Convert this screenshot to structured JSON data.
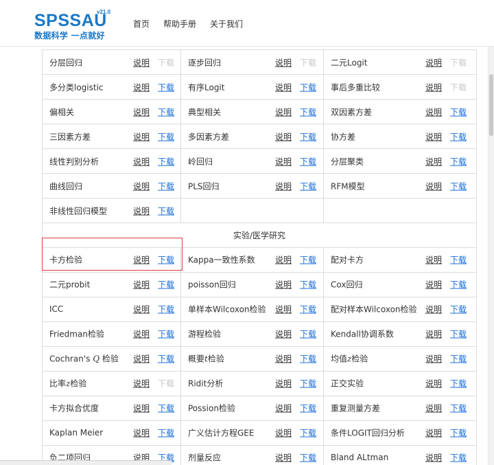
{
  "header": {
    "logo_text": "SPSSAU",
    "logo_version": "v21.0",
    "logo_slogan": "数据科学  一点就好",
    "nav": [
      "首页",
      "帮助手册",
      "关于我们"
    ]
  },
  "labels": {
    "explain": "说明",
    "download": "下载"
  },
  "colors": {
    "brand": "#1a78c9",
    "link": "#1a6ed8",
    "disabled": "#c8c8c8",
    "highlight": "#e03a3a"
  },
  "rows": [
    [
      {
        "name": "分层回归",
        "download": false
      },
      {
        "name": "逐步回归",
        "download": false
      },
      {
        "name": "二元Logit",
        "download": false
      }
    ],
    [
      {
        "name": "多分类logistic",
        "download": true
      },
      {
        "name": "有序Logit",
        "download": true
      },
      {
        "name": "事后多重比较",
        "download": false
      }
    ],
    [
      {
        "name": "偏相关",
        "download": true
      },
      {
        "name": "典型相关",
        "download": true
      },
      {
        "name": "双因素方差",
        "download": true
      }
    ],
    [
      {
        "name": "三因素方差",
        "download": true
      },
      {
        "name": "多因素方差",
        "download": true
      },
      {
        "name": "协方差",
        "download": true
      }
    ],
    [
      {
        "name": "线性判别分析",
        "download": true
      },
      {
        "name": "岭回归",
        "download": true
      },
      {
        "name": "分层聚类",
        "download": true
      }
    ],
    [
      {
        "name": "曲线回归",
        "download": true
      },
      {
        "name": "PLS回归",
        "download": true
      },
      {
        "name": "RFM模型",
        "download": true
      }
    ],
    [
      {
        "name": "非线性回归模型",
        "download": true
      },
      null,
      null
    ]
  ],
  "section": {
    "title": "实验/医学研究",
    "rows": [
      [
        {
          "name": "卡方检验",
          "download": true
        },
        {
          "name": "Kappa一致性系数",
          "download": true
        },
        {
          "name": "配对卡方",
          "download": true
        }
      ],
      [
        {
          "name": "二元probit",
          "download": true
        },
        {
          "name": "poisson回归",
          "download": true
        },
        {
          "name": "Cox回归",
          "download": true
        }
      ],
      [
        {
          "name": "ICC",
          "download": true
        },
        {
          "name": "单样本Wilcoxon检验",
          "download": true
        },
        {
          "name": "配对样本Wilcoxon检验",
          "download": true
        }
      ],
      [
        {
          "name": "Friedman检验",
          "download": true
        },
        {
          "name": "游程检验",
          "download": true
        },
        {
          "name": "Kendall协调系数",
          "download": true
        }
      ],
      [
        {
          "name": "Cochran's Q 检验",
          "download": true
        },
        {
          "name": "概要t检验",
          "download": true
        },
        {
          "name": "均值z检验",
          "download": true
        }
      ],
      [
        {
          "name": "比率z检验",
          "download": false
        },
        {
          "name": "Ridit分析",
          "download": true
        },
        {
          "name": "正交实验",
          "download": true
        }
      ],
      [
        {
          "name": "卡方拟合优度",
          "download": true
        },
        {
          "name": "Possion检验",
          "download": true
        },
        {
          "name": "重复测量方差",
          "download": true
        }
      ],
      [
        {
          "name": "Kaplan Meier",
          "download": true
        },
        {
          "name": "广义估计方程GEE",
          "download": true
        },
        {
          "name": "条件LOGIT回归分析",
          "download": true
        }
      ],
      [
        {
          "name": "负二项回归",
          "download": true
        },
        {
          "name": "剂量反应",
          "download": true
        },
        {
          "name": "Bland ALtman",
          "download": true
        }
      ]
    ]
  }
}
